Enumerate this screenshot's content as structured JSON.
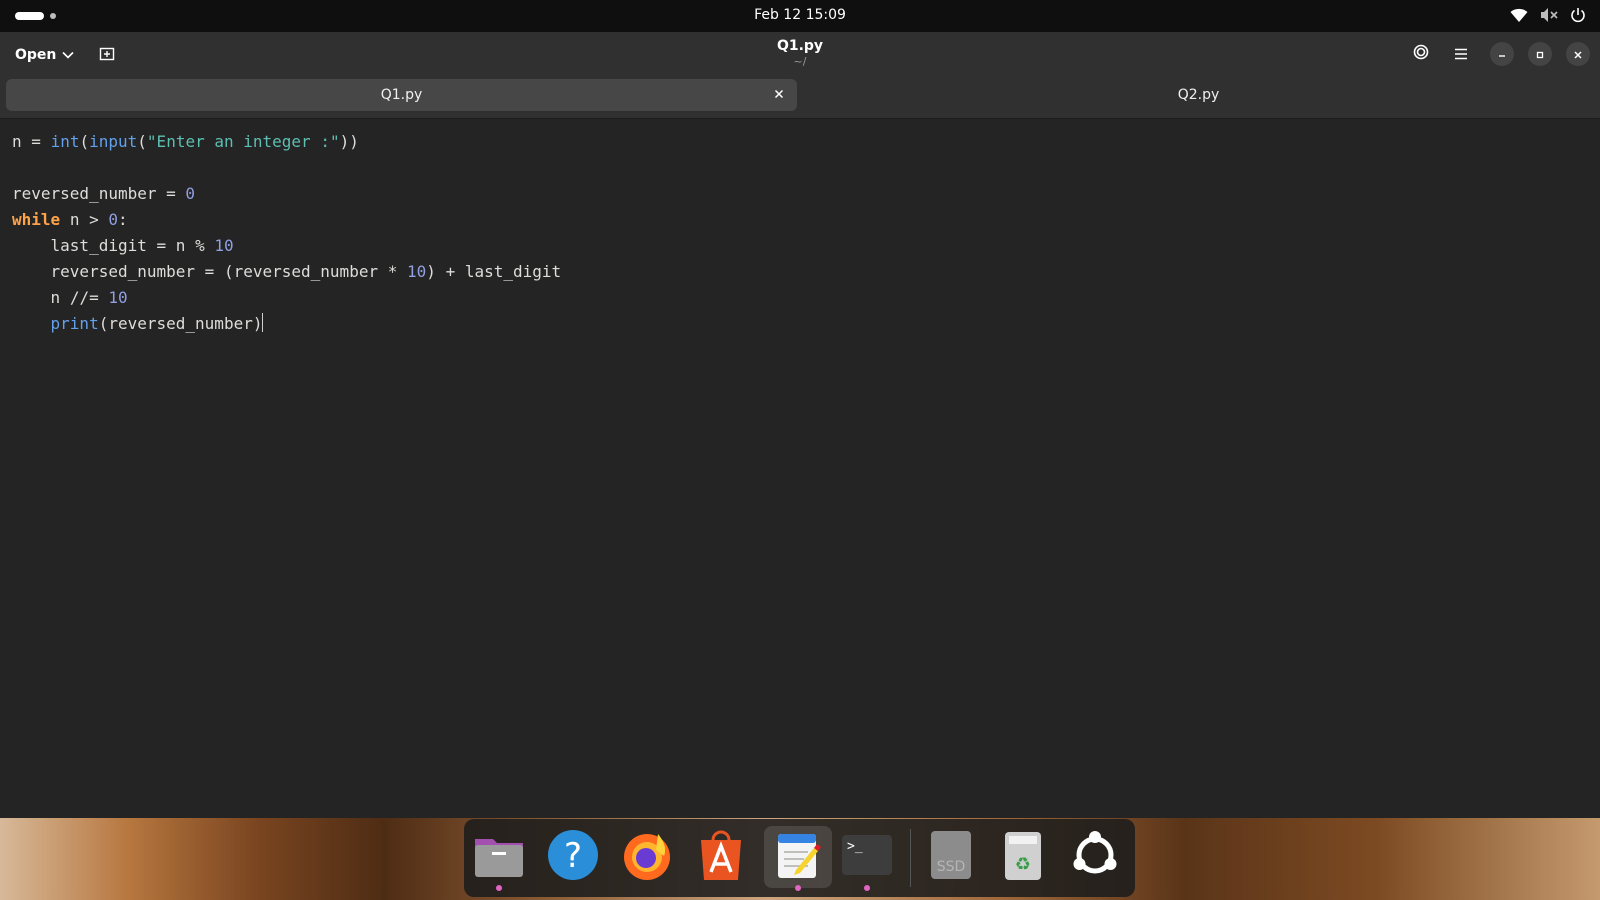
{
  "topbar": {
    "datetime": "Feb 12  15:09",
    "icons": [
      "wifi-icon",
      "volume-muted-icon",
      "power-icon"
    ]
  },
  "header": {
    "open_label": "Open",
    "title": "Q1.py",
    "subtitle": "~/",
    "icons": [
      "new-tab-icon",
      "settings-icon",
      "menu-icon",
      "minimize-icon",
      "maximize-icon",
      "close-icon"
    ]
  },
  "tabs": [
    {
      "label": "Q1.py",
      "active": true
    },
    {
      "label": "Q2.py",
      "active": false
    }
  ],
  "editor": {
    "lines": [
      "n = int(input(\"Enter an integer :\"))",
      "",
      "reversed_number = 0",
      "while n > 0:",
      "    last_digit = n % 10",
      "    reversed_number = (reversed_number * 10) + last_digit",
      "    n //= 10",
      "    print(reversed_number)"
    ],
    "colors": {
      "keyword": "#ffa348",
      "builtin": "#62a0ea",
      "string": "#5dbfb2",
      "number": "#8f9fe0",
      "text": "#deddda"
    }
  },
  "dock": {
    "apps": [
      {
        "name": "files",
        "icon": "files-icon",
        "running": true
      },
      {
        "name": "help",
        "icon": "help-icon",
        "running": false
      },
      {
        "name": "firefox",
        "icon": "firefox-icon",
        "running": false
      },
      {
        "name": "app-center",
        "icon": "app-center-icon",
        "running": false
      },
      {
        "name": "text-editor",
        "icon": "text-editor-icon",
        "running": true,
        "focused": true
      },
      {
        "name": "terminal",
        "icon": "terminal-icon",
        "running": true
      },
      {
        "name": "ssd",
        "icon": "ssd-drive-icon",
        "label": "SSD",
        "running": false
      },
      {
        "name": "trash",
        "icon": "trash-icon",
        "running": false
      },
      {
        "name": "show-apps",
        "icon": "ubuntu-logo-icon",
        "running": false
      }
    ]
  }
}
